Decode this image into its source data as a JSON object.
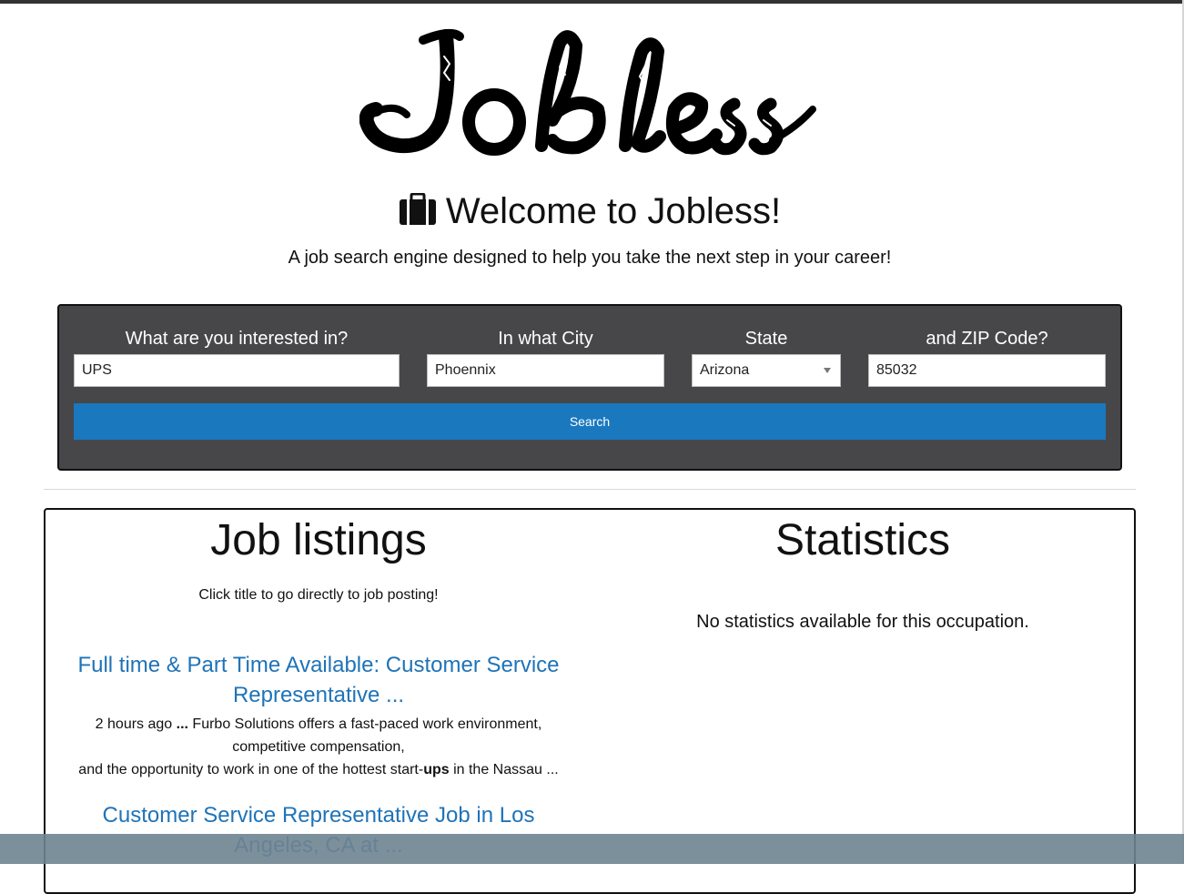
{
  "logo": {
    "text": "Jobless"
  },
  "header": {
    "welcome": "Welcome to Jobless!",
    "subtitle": "A job search engine designed to help you take the next step in your career!"
  },
  "search": {
    "interest_label": "What are you interested in?",
    "interest_value": "UPS",
    "city_label": "In what City",
    "city_value": "Phoennix",
    "state_label": "State",
    "state_value": "Arizona",
    "zip_label": "and ZIP Code?",
    "zip_value": "85032",
    "button_label": "Search"
  },
  "listings": {
    "title": "Job listings",
    "hint": "Click title to go directly to job posting!",
    "jobs": [
      {
        "title": "Full time & Part Time Available: Customer Service Representative ...",
        "snippet_line1_pre": "2 hours ago ",
        "snippet_line1_bold": "...",
        "snippet_line1_post": " Furbo Solutions offers a fast-paced work environment, competitive compensation,",
        "snippet_line2_pre": "and the opportunity to work in one of the hottest start-",
        "snippet_line2_bold": "ups",
        "snippet_line2_post": " in the Nassau ..."
      },
      {
        "title": "Customer Service Representative Job in Los Angeles, CA at ..."
      }
    ]
  },
  "statistics": {
    "title": "Statistics",
    "message": "No statistics available for this occupation."
  },
  "colors": {
    "panel_bg": "#474749",
    "button_bg": "#1a78bf",
    "link": "#1f73b7",
    "overlay": "#6e8491"
  }
}
